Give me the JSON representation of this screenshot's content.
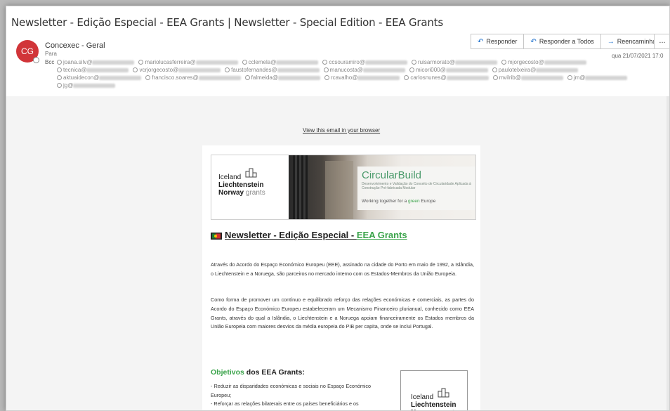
{
  "email": {
    "subject": "Newsletter - Edição Especial - EEA Grants | Newsletter - Special Edition - EEA Grants",
    "sender_initials": "CG",
    "sender_name": "Concexec - Geral",
    "to_label": "Para",
    "bcc_label": "Bcc",
    "recipients_visible": [
      "joana.silv@",
      "mariolucasferreira@",
      "cclemela@",
      "ccsouramiro@",
      "ruisarmorato@",
      "mjorgecosto@",
      "tecnica@",
      "vcrjorgecosto@",
      "faustofernandes@",
      "manucosta@",
      "micori000@",
      "paulotelxeira@",
      "aktuaidecon@",
      "francisco.soares@",
      "falmeida@",
      "rcavalho@",
      "carlosnunes@",
      "mvilrib@",
      "jm@",
      "jg@"
    ],
    "date": "qua 21/07/2021 17:0"
  },
  "actions": {
    "reply": "Responder",
    "reply_all": "Responder a Todos",
    "forward": "Reencaminhar",
    "more": "..."
  },
  "newsletter": {
    "view_in_browser": "View this email in your browser",
    "logo": {
      "line1": "Iceland",
      "line2": "Liechtenstein",
      "line3a": "Norway",
      "line3b": " grants"
    },
    "banner": {
      "title": "CircularBuild",
      "subtitle": "Desenvolvimento e Validação do Conceito de Circularidade Aplicada à Construção Pré-fabricada Modular",
      "working_prefix": "Working together for a ",
      "working_green": "green",
      "working_suffix": " Europe"
    },
    "title_main": "Newsletter - Edição Especial - ",
    "title_eea": "EEA Grants",
    "p1": "Através do Acordo do Espaço Económico Europeu (EEE), assinado na cidade do Porto em maio de 1992, a Islândia, o Liechtenstein e a Noruega, são parceiros no mercado interno com os Estados-Membros da União Europeia.",
    "p2": "Como forma de promover um contínuo e equilibrado reforço das relações económicas e comerciais, as partes do Acordo do Espaço Económico Europeu estabeleceram um Mecanismo Financeiro plurianual, conhecido como EEA Grants, através do qual a Islândia, o Liechtenstein e a Noruega apoiam financeiramente os Estados membros da União Europeia com maiores desvios da média europeia do PIB per capita, onde se inclui Portugal.",
    "obj_green": "Objetivos",
    "obj_rest": " dos EEA Grants:",
    "obj_item1": "- Reduzir as disparidades económicas e sociais no Espaço Económico Europeu;",
    "obj_item2": "- Reforçar as relações bilaterais entre os países beneficiários e os"
  },
  "colors": {
    "avatar": "#d13438",
    "accent_blue": "#0a64c8",
    "eea_green": "#3aa34a",
    "circularbuild_green": "#4a9a6a"
  }
}
